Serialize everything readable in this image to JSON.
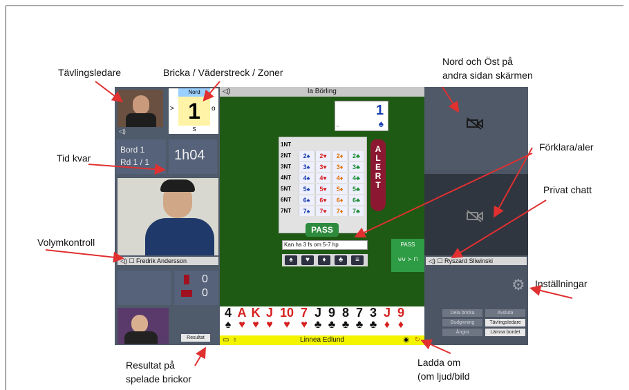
{
  "annotations": {
    "tavlingsledare": "Tävlingsledare",
    "bricka": "Bricka / Väderstreck / Zoner",
    "nord_ost_1": "Nord och Öst på",
    "nord_ost_2": "andra sidan skärmen",
    "tid_kvar": "Tid kvar",
    "forklara": "Förklara/aler",
    "privat_chatt": "Privat chatt",
    "volym": "Volymkontroll",
    "installningar": "Inställningar",
    "resultat_1": "Resultat på",
    "resultat_2": "spelade brickor",
    "ladda_1": "Ladda om",
    "ladda_2": "(om ljud/bild"
  },
  "board": {
    "north": "Nord",
    "number": "1",
    "south": "S",
    "west": ">",
    "east": "o"
  },
  "info": {
    "bord": "Bord 1",
    "rd": "Rd 1 / 1",
    "time": "1h04"
  },
  "players": {
    "north_name": "la Börling",
    "west_name": "Fredrik Andersson",
    "east_name": "Ryszard Sliwinski",
    "south_name": "Linnea Edlund"
  },
  "scores": {
    "a": "0",
    "b": "0"
  },
  "result_button": "Resultat",
  "bidding": {
    "levels": [
      "1NT",
      "2NT",
      "3NT",
      "4NT",
      "5NT",
      "6NT",
      "7NT"
    ],
    "rows": [
      [
        "",
        "",
        "",
        ""
      ],
      [
        "2♠",
        "2♥",
        "2♦",
        "2♣"
      ],
      [
        "3♠",
        "3♥",
        "3♦",
        "3♣"
      ],
      [
        "4♠",
        "4♥",
        "4♦",
        "4♣"
      ],
      [
        "5♠",
        "5♥",
        "5♦",
        "5♣"
      ],
      [
        "6♠",
        "6♥",
        "6♦",
        "6♣"
      ],
      [
        "7♠",
        "7♥",
        "7♦",
        "7♣"
      ]
    ],
    "alert": "ALERT",
    "pass": "PASS",
    "explanation": "Kan ha 3 fs om 5-7 hp",
    "suits": [
      "♠",
      "♥",
      "♦",
      "♣",
      "≡"
    ]
  },
  "dummy": {
    "value": "1",
    "suit": "♠"
  },
  "green_tag": {
    "top": "PASS",
    "bottom": "⊍⊍ ≻ ⊓"
  },
  "hand": [
    {
      "rank": "4",
      "suit": "♠",
      "color": "black"
    },
    {
      "rank": "A",
      "suit": "♥",
      "color": "red"
    },
    {
      "rank": "K",
      "suit": "♥",
      "color": "red"
    },
    {
      "rank": "J",
      "suit": "♥",
      "color": "red"
    },
    {
      "rank": "10",
      "suit": "♥",
      "color": "red"
    },
    {
      "rank": "7",
      "suit": "♥",
      "color": "red"
    },
    {
      "rank": "J",
      "suit": "♣",
      "color": "black"
    },
    {
      "rank": "9",
      "suit": "♣",
      "color": "black"
    },
    {
      "rank": "8",
      "suit": "♣",
      "color": "black"
    },
    {
      "rank": "7",
      "suit": "♣",
      "color": "black"
    },
    {
      "rank": "3",
      "suit": "♣",
      "color": "black"
    },
    {
      "rank": "J",
      "suit": "♦",
      "color": "red"
    },
    {
      "rank": "9",
      "suit": "♦",
      "color": "red"
    }
  ],
  "settings_buttons": {
    "b1": "Dela bricka",
    "b2": "Avsluta",
    "b3": "Budgivning",
    "b4": "Tävlingsledare",
    "b5": "Ångra",
    "b6": "Lämna bordet"
  },
  "icons": {
    "speaker": "speaker-icon",
    "chat": "chat-icon",
    "camera_off": "camera-off-icon",
    "gear": "gear-icon",
    "eye": "eye-icon",
    "reload": "reload-icon",
    "mic": "mic-icon",
    "video": "video-icon"
  },
  "colors": {
    "table_green": "#1f5a14",
    "alert_red": "#8b1830",
    "pass_green": "#2e8b3e",
    "south_yellow": "#f4f400",
    "annotation_arrow": "#e03030"
  }
}
